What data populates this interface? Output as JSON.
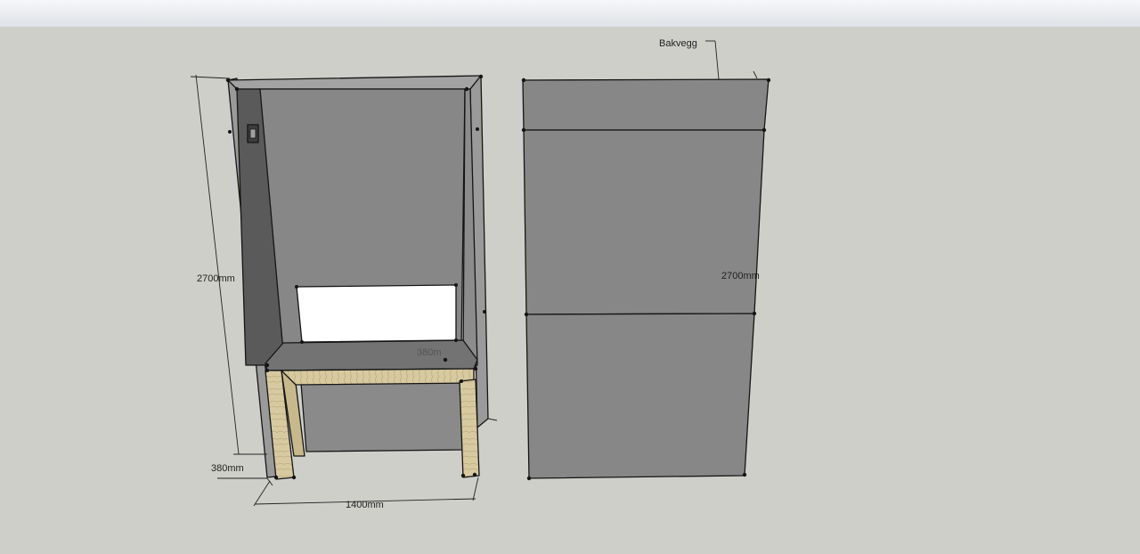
{
  "labels": {
    "height_left": "2700mm",
    "depth_left": "380mm",
    "width_bottom": "1400mm",
    "shelf_partial": "380m",
    "back_wall": "Bakvegg",
    "height_right": "2700mm"
  },
  "colors": {
    "background": "#cfcfca",
    "sky": "#eef0f3",
    "panel_face": "#858585",
    "panel_edge": "#a9a9a9",
    "panel_dark": "#4f4f4f",
    "wood": "#d8caa0",
    "outline": "#151515"
  }
}
